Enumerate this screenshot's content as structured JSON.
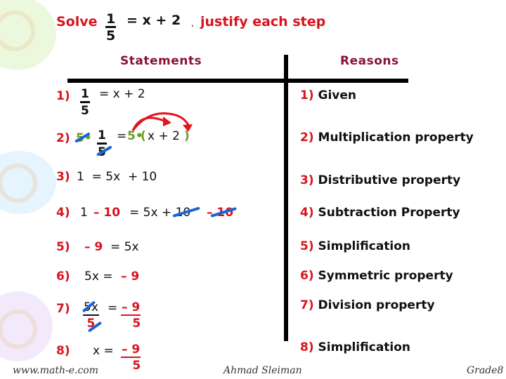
{
  "title": {
    "prefix": "Solve",
    "equation_num": "1",
    "equation_den": "5",
    "equation_rhs": "= x + 2",
    "comma": ",",
    "suffix": "justify each step"
  },
  "headers": {
    "statements": "Statements",
    "reasons": "Reasons"
  },
  "statements": [
    {
      "num": "1)",
      "frac_num": "1",
      "frac_den": "5",
      "rhs": "= x + 2"
    },
    {
      "num": "2)",
      "mult_left": "5•",
      "frac_num": "1",
      "frac_den": "5",
      "eq": "=",
      "mult_right": "5•",
      "paren_open": "(",
      "inner": "x + 2",
      "paren_close": ")"
    },
    {
      "num": "3)",
      "text": "1  = 5x  + 10"
    },
    {
      "num": "4)",
      "lhs_a": "1",
      "lhs_b": "– 10",
      "rhs_a": "= 5x + 10",
      "rhs_b": "– 10"
    },
    {
      "num": "5)",
      "lhs": "– 9",
      "rhs": "= 5x"
    },
    {
      "num": "6)",
      "lhs": "5x =",
      "rhs": "– 9"
    },
    {
      "num": "7)",
      "frac_num": "5x",
      "frac_den": "5",
      "eq": "=",
      "r_num": "– 9",
      "r_den": "5"
    },
    {
      "num": "8)",
      "lhs": "x =",
      "r_num": "– 9",
      "r_den": "5"
    }
  ],
  "reasons": [
    {
      "num": "1)",
      "text": "Given"
    },
    {
      "num": "2)",
      "text": "Multiplication property"
    },
    {
      "num": "3)",
      "text": "Distributive property"
    },
    {
      "num": "4)",
      "text": "Subtraction Property"
    },
    {
      "num": "5)",
      "text": "Simplification"
    },
    {
      "num": "6)",
      "text": "Symmetric property"
    },
    {
      "num": "7)",
      "text": "Division property"
    },
    {
      "num": "8)",
      "text": "Simplification"
    }
  ],
  "footer": {
    "website": "www.math-e.com",
    "author": "Ahmad Sleiman",
    "grade": "Grade8"
  },
  "colors": {
    "step_number": "#d7141e",
    "header": "#8a1233",
    "multiplier": "#6f9a1f",
    "cancel_mark": "#1d63d6",
    "distribution_arrow": "#e3141e"
  }
}
